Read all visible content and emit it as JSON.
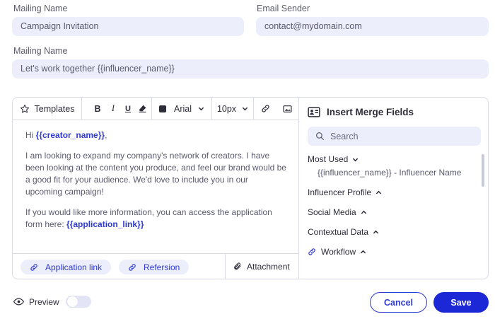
{
  "form": {
    "mailing_name_label": "Mailing Name",
    "mailing_name_value": "Campaign Invitation",
    "email_sender_label": "Email Sender",
    "email_sender_value": "contact@mydomain.com",
    "subject_label": "Mailing Name",
    "subject_value": "Let's work together {{influencer_name}}"
  },
  "toolbar": {
    "templates_label": "Templates",
    "bold_label": "B",
    "italic_label": "I",
    "underline_label": "U",
    "font_label": "Arial",
    "size_label": "10px"
  },
  "editor": {
    "greeting_prefix": "Hi ",
    "greeting_tag": "{{creator_name}}",
    "greeting_suffix": ",",
    "paragraph1": "I am looking to expand my company's network of creators. I have been looking at the content you produce, and feel our brand would be a good fit for your audience. We'd love to include you in our upcoming campaign!",
    "paragraph2_prefix": "If you would like more information, you can access the application form here: ",
    "paragraph2_tag": "{{application_link}}"
  },
  "bottom_bar": {
    "chip1_label": "Application link",
    "chip2_label": "Refersion",
    "attachment_label": "Attachment"
  },
  "merge_fields": {
    "title": "Insert Merge Fields",
    "search_placeholder": "Search",
    "groups": [
      {
        "label": "Most Used",
        "expanded": true
      },
      {
        "label": "Influencer Profile",
        "expanded": false
      },
      {
        "label": "Social Media",
        "expanded": false
      },
      {
        "label": "Contextual Data",
        "expanded": false
      },
      {
        "label": "Workflow",
        "expanded": false
      }
    ],
    "most_used_item": "{{influencer_name}} - Influencer Name"
  },
  "footer": {
    "preview_label": "Preview",
    "cancel_label": "Cancel",
    "save_label": "Save"
  },
  "colors": {
    "accent": "#2f3ad1",
    "field_bg": "#eceefb",
    "save_bg": "#1c27d6"
  }
}
